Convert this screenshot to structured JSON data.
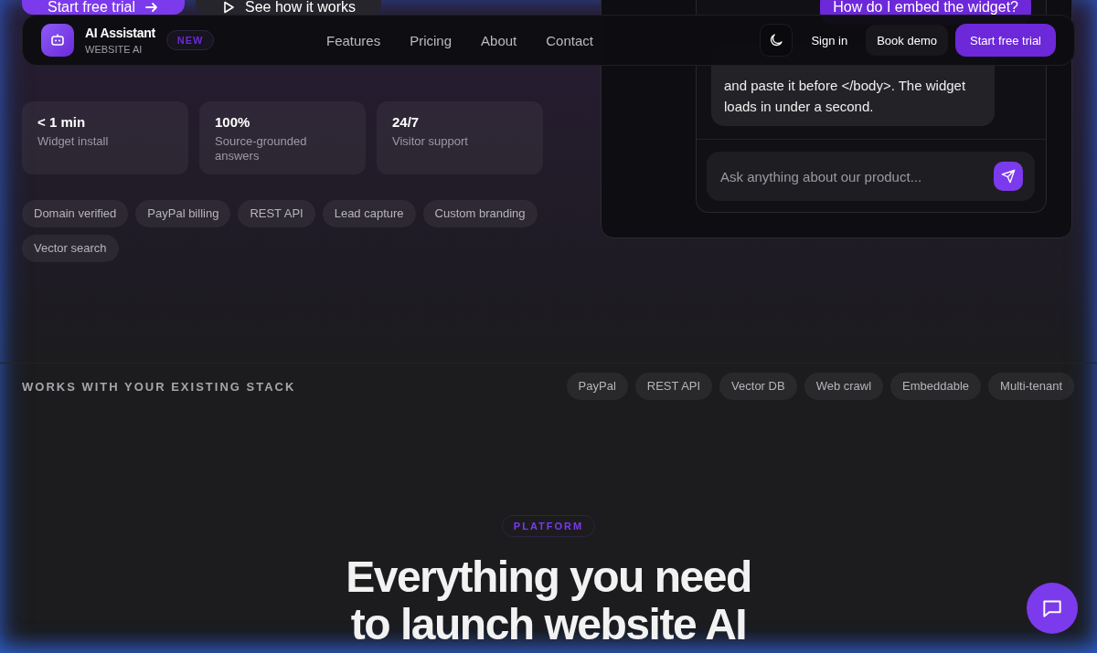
{
  "nav": {
    "brand": {
      "name": "AI Assistant",
      "subtitle": "WEBSITE AI",
      "badge": "NEW"
    },
    "links": [
      "Features",
      "Pricing",
      "About",
      "Contact"
    ],
    "sign_in": "Sign in",
    "book_demo": "Book demo",
    "cta": "Start free trial"
  },
  "hero": {
    "buttons": [
      {
        "label": "Start free trial",
        "kind": "primary"
      },
      {
        "label": "See how it works",
        "kind": "secondary"
      }
    ],
    "stats": [
      {
        "value": "< 1 min",
        "label": "Widget install"
      },
      {
        "value": "100%",
        "label": "Source-grounded answers"
      },
      {
        "value": "24/7",
        "label": "Visitor support"
      }
    ],
    "features": [
      "Domain verified",
      "PayPal billing",
      "REST API",
      "Lead capture",
      "Custom branding",
      "Vector search"
    ]
  },
  "chat": {
    "user_message": "How do I embed the widget?",
    "bot_message": "and paste it before </body>. The widget loads in under a second.",
    "input": {
      "placeholder": "Ask anything about our product..."
    }
  },
  "stack": {
    "heading": "WORKS WITH YOUR EXISTING STACK",
    "items": [
      "PayPal",
      "REST API",
      "Vector DB",
      "Web crawl",
      "Embeddable",
      "Multi-tenant"
    ]
  },
  "platform": {
    "eyebrow": "PLATFORM",
    "heading_lines": [
      "Everything you need",
      "to launch website AI"
    ]
  }
}
